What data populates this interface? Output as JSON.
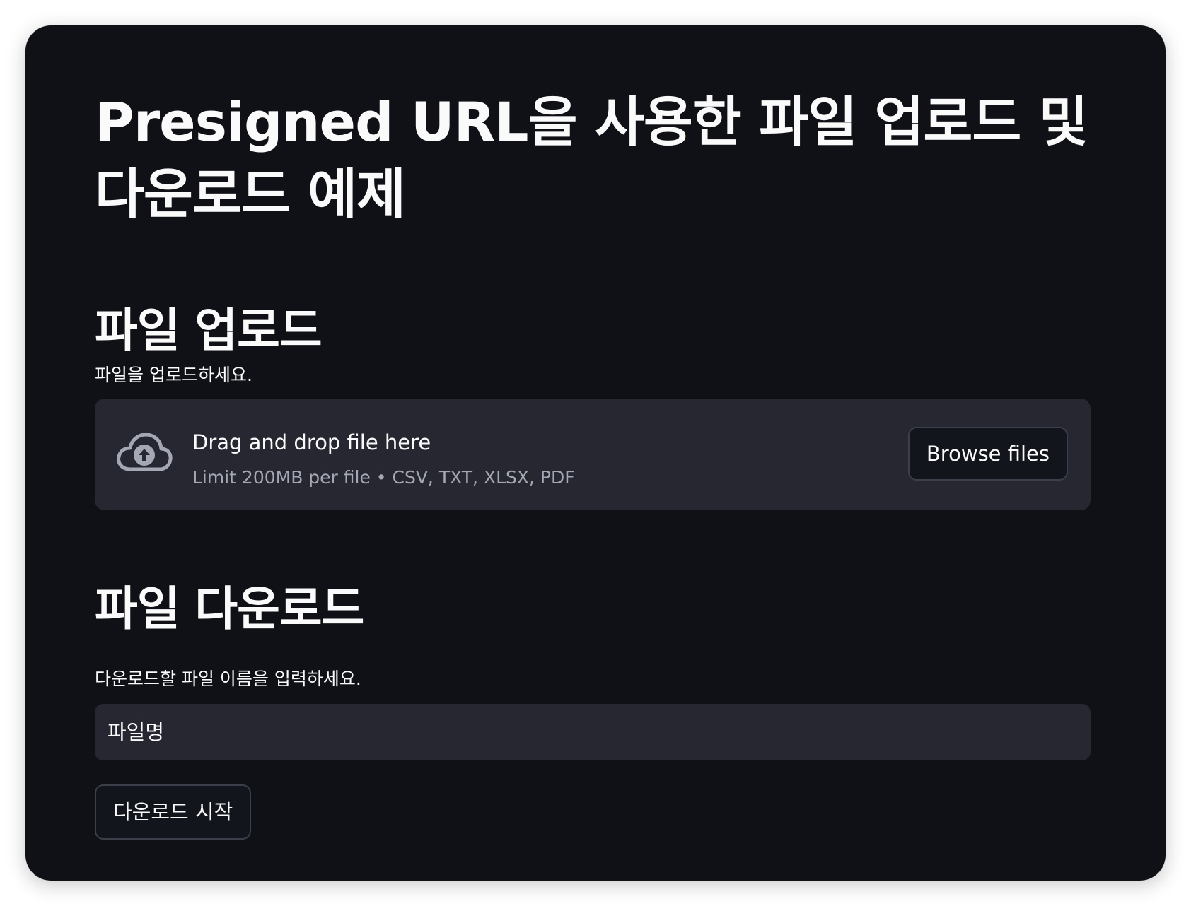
{
  "page": {
    "title": "Presigned URL을 사용한 파일 업로드 및 다운로드 예제"
  },
  "upload": {
    "heading": "파일 업로드",
    "label": "파일을 업로드하세요.",
    "dropzone_text": "Drag and drop file here",
    "dropzone_hint": "Limit 200MB per file • CSV, TXT, XLSX, PDF",
    "browse_label": "Browse files",
    "icon": "cloud-upload-icon"
  },
  "download": {
    "heading": "파일 다운로드",
    "label": "다운로드할 파일 이름을 입력하세요.",
    "input_placeholder": "파일명",
    "input_value": "",
    "button_label": "다운로드 시작"
  },
  "colors": {
    "background": "#0f1117",
    "surface": "#262730",
    "text": "#fafafa",
    "muted_text": "#a3a8b4",
    "border": "#3c3f4a"
  }
}
